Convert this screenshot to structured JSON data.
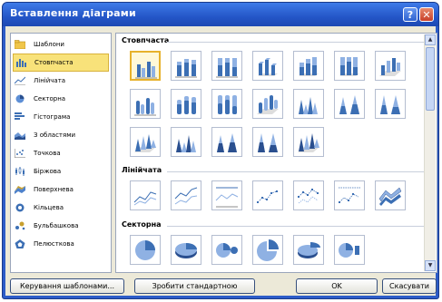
{
  "window": {
    "title": "Вставлення діаграми",
    "help_label": "?",
    "close_label": "✕"
  },
  "categories": [
    {
      "label": "Шаблони",
      "icon": "folder-icon"
    },
    {
      "label": "Стовпчаста",
      "icon": "column-chart-icon",
      "selected": true
    },
    {
      "label": "Лінійчата",
      "icon": "line-chart-icon"
    },
    {
      "label": "Секторна",
      "icon": "pie-chart-icon"
    },
    {
      "label": "Гістограма",
      "icon": "bar-chart-icon"
    },
    {
      "label": "З областями",
      "icon": "area-chart-icon"
    },
    {
      "label": "Точкова",
      "icon": "scatter-chart-icon"
    },
    {
      "label": "Біржова",
      "icon": "stock-chart-icon"
    },
    {
      "label": "Поверхнева",
      "icon": "surface-chart-icon"
    },
    {
      "label": "Кільцева",
      "icon": "doughnut-chart-icon"
    },
    {
      "label": "Бульбашкова",
      "icon": "bubble-chart-icon"
    },
    {
      "label": "Пелюсткова",
      "icon": "radar-chart-icon"
    }
  ],
  "sections": {
    "column": {
      "title": "Стовпчаста"
    },
    "line": {
      "title": "Лінійчата"
    },
    "pie": {
      "title": "Секторна"
    }
  },
  "buttons": {
    "manage_templates": "Керування шаблонами...",
    "set_default": "Зробити стандартною",
    "ok": "OK",
    "cancel": "Скасувати"
  },
  "colors": {
    "title_bar": "#2456c8",
    "selection": "#f8e27a",
    "chart_blue": "#3c6fb4"
  }
}
